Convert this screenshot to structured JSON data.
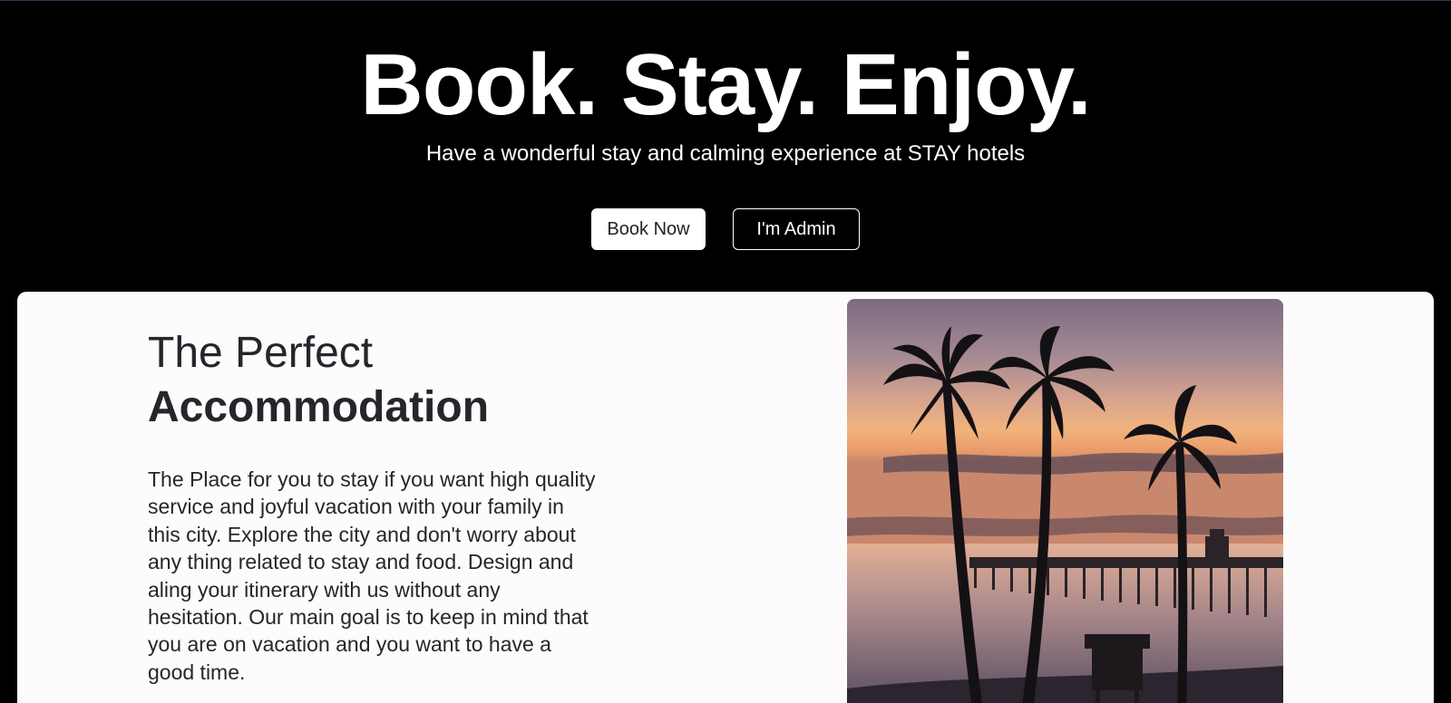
{
  "hero": {
    "title": "Book. Stay. Enjoy.",
    "subtitle": "Have a wonderful stay and calming experience at STAY hotels",
    "book_button": "Book Now",
    "admin_button": "I'm Admin"
  },
  "about": {
    "heading_line1": "The Perfect",
    "heading_line2": "Accommodation",
    "body": "The Place for you to stay if you want high quality service and joyful vacation with your family in this city. Explore the city and don't worry about any thing related to stay and food. Design and aling your itinerary with us without any hesitation. Our main goal is to keep in mind that you are on vacation and you want to have a good time."
  },
  "image": {
    "subject": "palm-trees-sunset-pier"
  },
  "colors": {
    "background": "#000000",
    "card": "#fdfbfc",
    "text_dark": "#25262b",
    "text_light": "#ffffff"
  }
}
